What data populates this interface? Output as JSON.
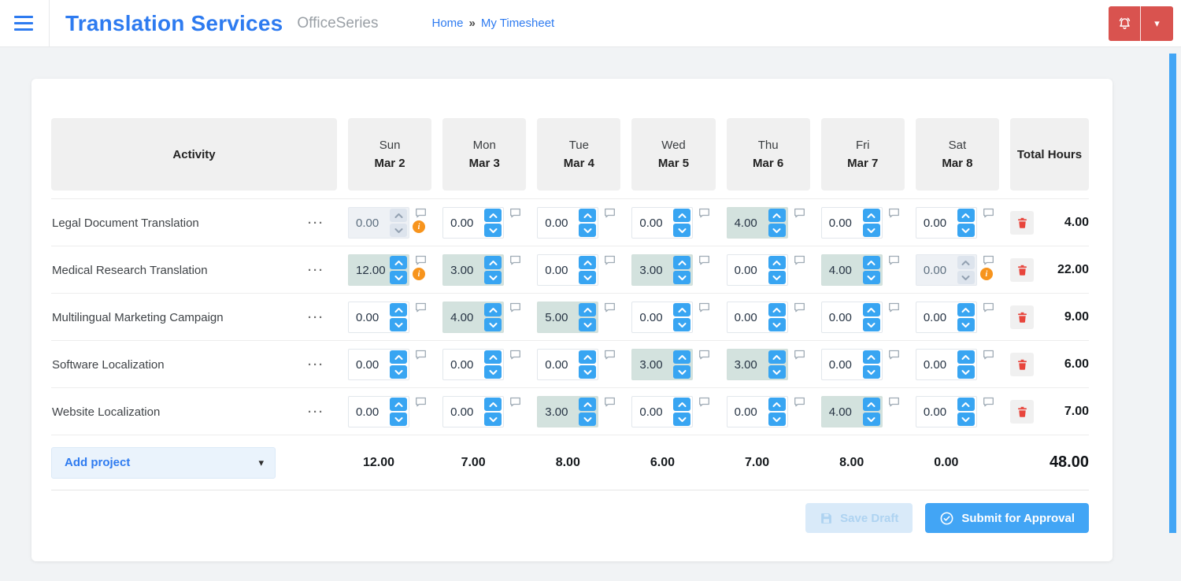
{
  "header": {
    "title": "Translation Services",
    "subtitle": "OfficeSeries",
    "breadcrumb": {
      "home": "Home",
      "separator": "»",
      "current": "My Timesheet"
    }
  },
  "icons": {
    "menu": "hamburger-icon",
    "notifications": "bell-icon",
    "account": "caret-down-icon",
    "caret_down": "▾",
    "ellipsis": "···",
    "info": "i",
    "comment": "speech-bubble-icon",
    "delete": "trash-icon",
    "save": "floppy-disk-icon",
    "submit": "check-circle-icon"
  },
  "colors": {
    "accent_blue": "#2e7bf0",
    "brand_red": "#d9534f",
    "spin_blue": "#38a5f2",
    "filled_green": "#d3e2de",
    "disabled_bg": "#eef1f5",
    "warn_orange": "#f7941d",
    "trash_red": "#e8453c",
    "scrollbar_blue": "#42a5f5",
    "page_bg": "#f1f3f5"
  },
  "timesheet": {
    "activity_header": "Activity",
    "total_header": "Total Hours",
    "columns": [
      {
        "day": "Sun",
        "date": "Mar 2"
      },
      {
        "day": "Mon",
        "date": "Mar 3"
      },
      {
        "day": "Tue",
        "date": "Mar 4"
      },
      {
        "day": "Wed",
        "date": "Mar 5"
      },
      {
        "day": "Thu",
        "date": "Mar 6"
      },
      {
        "day": "Fri",
        "date": "Mar 7"
      },
      {
        "day": "Sat",
        "date": "Mar 8"
      }
    ],
    "rows": [
      {
        "activity": "Legal Document Translation",
        "total": "4.00",
        "cells": [
          {
            "value": "0.00",
            "state": "disabled",
            "info": true
          },
          {
            "value": "0.00",
            "state": "normal",
            "info": false
          },
          {
            "value": "0.00",
            "state": "normal",
            "info": false
          },
          {
            "value": "0.00",
            "state": "normal",
            "info": false
          },
          {
            "value": "4.00",
            "state": "filled",
            "info": false
          },
          {
            "value": "0.00",
            "state": "normal",
            "info": false
          },
          {
            "value": "0.00",
            "state": "normal",
            "info": false
          }
        ]
      },
      {
        "activity": "Medical Research Translation",
        "total": "22.00",
        "cells": [
          {
            "value": "12.00",
            "state": "filled",
            "info": true
          },
          {
            "value": "3.00",
            "state": "filled",
            "info": false
          },
          {
            "value": "0.00",
            "state": "normal",
            "info": false
          },
          {
            "value": "3.00",
            "state": "filled",
            "info": false
          },
          {
            "value": "0.00",
            "state": "normal",
            "info": false
          },
          {
            "value": "4.00",
            "state": "filled",
            "info": false
          },
          {
            "value": "0.00",
            "state": "disabled",
            "info": true
          }
        ]
      },
      {
        "activity": "Multilingual Marketing Campaign",
        "total": "9.00",
        "cells": [
          {
            "value": "0.00",
            "state": "normal",
            "info": false
          },
          {
            "value": "4.00",
            "state": "filled",
            "info": false
          },
          {
            "value": "5.00",
            "state": "filled",
            "info": false
          },
          {
            "value": "0.00",
            "state": "normal",
            "info": false
          },
          {
            "value": "0.00",
            "state": "normal",
            "info": false
          },
          {
            "value": "0.00",
            "state": "normal",
            "info": false
          },
          {
            "value": "0.00",
            "state": "normal",
            "info": false
          }
        ]
      },
      {
        "activity": "Software Localization",
        "total": "6.00",
        "cells": [
          {
            "value": "0.00",
            "state": "normal",
            "info": false
          },
          {
            "value": "0.00",
            "state": "normal",
            "info": false
          },
          {
            "value": "0.00",
            "state": "normal",
            "info": false
          },
          {
            "value": "3.00",
            "state": "filled",
            "info": false
          },
          {
            "value": "3.00",
            "state": "filled",
            "info": false
          },
          {
            "value": "0.00",
            "state": "normal",
            "info": false
          },
          {
            "value": "0.00",
            "state": "normal",
            "info": false
          }
        ]
      },
      {
        "activity": "Website Localization",
        "total": "7.00",
        "cells": [
          {
            "value": "0.00",
            "state": "normal",
            "info": false
          },
          {
            "value": "0.00",
            "state": "normal",
            "info": false
          },
          {
            "value": "3.00",
            "state": "filled",
            "info": false
          },
          {
            "value": "0.00",
            "state": "normal",
            "info": false
          },
          {
            "value": "0.00",
            "state": "normal",
            "info": false
          },
          {
            "value": "4.00",
            "state": "filled",
            "info": false
          },
          {
            "value": "0.00",
            "state": "normal",
            "info": false
          }
        ]
      }
    ],
    "footer": {
      "add_project_label": "Add project",
      "column_totals": [
        "12.00",
        "7.00",
        "8.00",
        "6.00",
        "7.00",
        "8.00",
        "0.00"
      ],
      "grand_total": "48.00"
    },
    "actions": {
      "save_draft": "Save Draft",
      "submit": "Submit for Approval"
    }
  }
}
